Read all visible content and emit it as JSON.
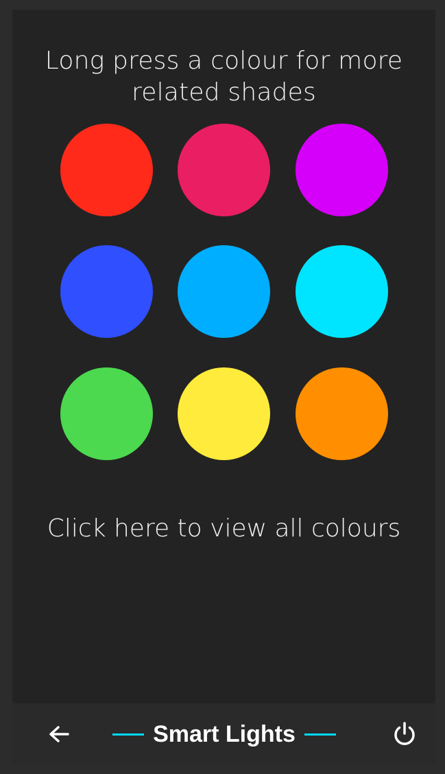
{
  "instruction": "Long press a colour for more related shades",
  "swatches": [
    {
      "name": "red",
      "color": "#ff2a1a"
    },
    {
      "name": "pink",
      "color": "#ea1e63"
    },
    {
      "name": "purple",
      "color": "#d500f9"
    },
    {
      "name": "blue",
      "color": "#304ffe"
    },
    {
      "name": "light-blue",
      "color": "#00aeff"
    },
    {
      "name": "cyan",
      "color": "#00e5ff"
    },
    {
      "name": "green",
      "color": "#4cd94f"
    },
    {
      "name": "yellow",
      "color": "#ffeb3b"
    },
    {
      "name": "orange",
      "color": "#ff8f00"
    }
  ],
  "view_all_label": "Click here to view all colours",
  "bottom_bar": {
    "back_icon": "arrow-left-icon",
    "title": "Smart Lights",
    "accent_color": "#00d9ff",
    "power_icon": "power-icon"
  }
}
